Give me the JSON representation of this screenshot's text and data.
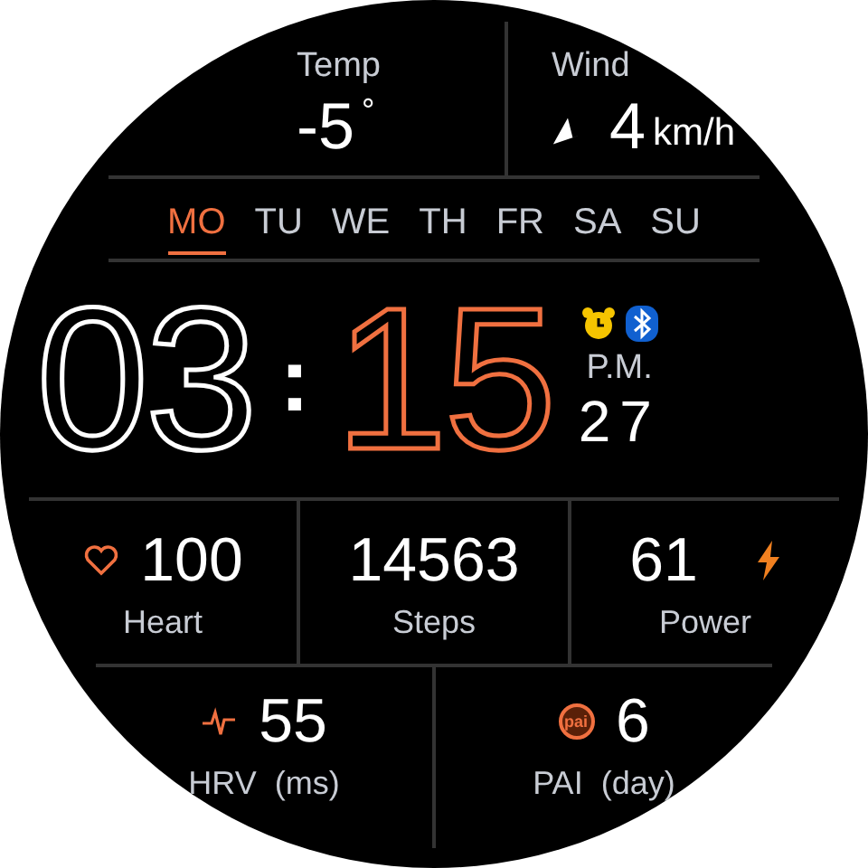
{
  "weather": {
    "temp": {
      "label": "Temp",
      "value": "-5",
      "unit": "°"
    },
    "wind": {
      "label": "Wind",
      "value": "4",
      "unit": "km/h"
    }
  },
  "days": [
    {
      "label": "MO",
      "selected": true
    },
    {
      "label": "TU",
      "selected": false
    },
    {
      "label": "WE",
      "selected": false
    },
    {
      "label": "TH",
      "selected": false
    },
    {
      "label": "FR",
      "selected": false
    },
    {
      "label": "SA",
      "selected": false
    },
    {
      "label": "SU",
      "selected": false
    }
  ],
  "time": {
    "hours": "03",
    "separator": ":",
    "minutes": "15",
    "period": "P.M.",
    "date": "27",
    "alarm_on": true,
    "bluetooth_on": true
  },
  "stats": [
    {
      "kind": "heart",
      "value": "100",
      "label": "Heart"
    },
    {
      "kind": "plain",
      "value": "14563",
      "label": "Steps"
    },
    {
      "kind": "power",
      "value": "61",
      "label": "Power"
    }
  ],
  "bottom_stats": [
    {
      "kind": "pulse",
      "value": "55",
      "label": "HRV",
      "unit": "(ms)"
    },
    {
      "kind": "pai",
      "badge": "pai",
      "value": "6",
      "label": "PAI",
      "unit": "(day)"
    }
  ]
}
